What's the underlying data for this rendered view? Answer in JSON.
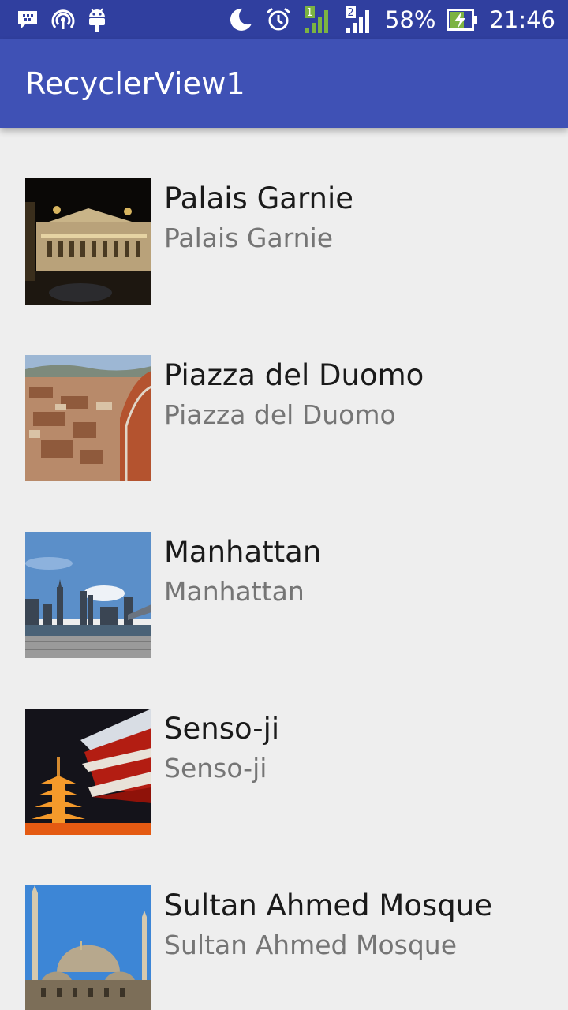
{
  "status_bar": {
    "battery_percent": "58%",
    "time": "21:46",
    "sim1_label": "1",
    "sim2_label": "2",
    "icons_left": [
      "bbm-icon",
      "hotspot-icon",
      "android-debug-icon"
    ],
    "icons_right": [
      "do-not-disturb-moon-icon",
      "alarm-clock-icon",
      "signal-sim1-icon",
      "signal-sim2-icon",
      "battery-charging-icon"
    ]
  },
  "app_bar": {
    "title": "RecyclerView1",
    "color": "#3f51b5",
    "status_color": "#303f9f"
  },
  "items": [
    {
      "title": "Palais Garnie",
      "subtitle": "Palais Garnie",
      "image": "palais-garnier-photo"
    },
    {
      "title": "Piazza del Duomo",
      "subtitle": "Piazza del Duomo",
      "image": "florence-duomo-photo"
    },
    {
      "title": "Manhattan",
      "subtitle": "Manhattan",
      "image": "manhattan-skyline-photo"
    },
    {
      "title": "Senso-ji",
      "subtitle": "Senso-ji",
      "image": "sensoji-temple-photo"
    },
    {
      "title": "Sultan Ahmed Mosque",
      "subtitle": "Sultan Ahmed Mosque",
      "image": "blue-mosque-photo"
    }
  ]
}
